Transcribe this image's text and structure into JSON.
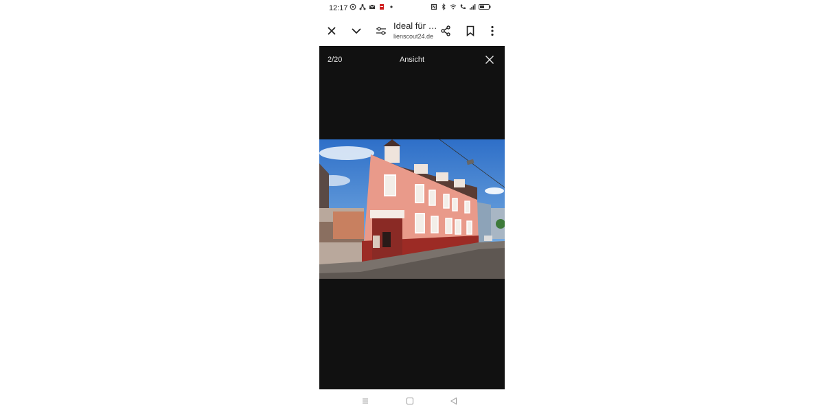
{
  "status_bar": {
    "time": "12:17",
    "left_icons": [
      "whatsapp-icon",
      "network-icon",
      "mail-icon",
      "pdf-icon",
      "dot-icon"
    ],
    "right_icons": [
      "nfc-icon",
      "bluetooth-icon",
      "wifi-icon",
      "call-icon",
      "signal-icon",
      "battery-icon"
    ]
  },
  "toolbar": {
    "title": "Ideal für …",
    "subtitle": "lienscout24.de",
    "icons": [
      "close-icon",
      "chevron-down-icon",
      "tune-icon",
      "share-icon",
      "bookmark-icon",
      "more-vert-icon"
    ]
  },
  "viewer": {
    "counter": "2/20",
    "title": "Ansicht",
    "close_icon": "close-icon",
    "background": "#111111"
  },
  "nav": {
    "icons": [
      "menu-icon",
      "home-icon",
      "back-icon"
    ]
  },
  "colors": {
    "viewer_bg": "#111111",
    "facade": "#e99a8a",
    "sky": "#3f7fd0"
  }
}
